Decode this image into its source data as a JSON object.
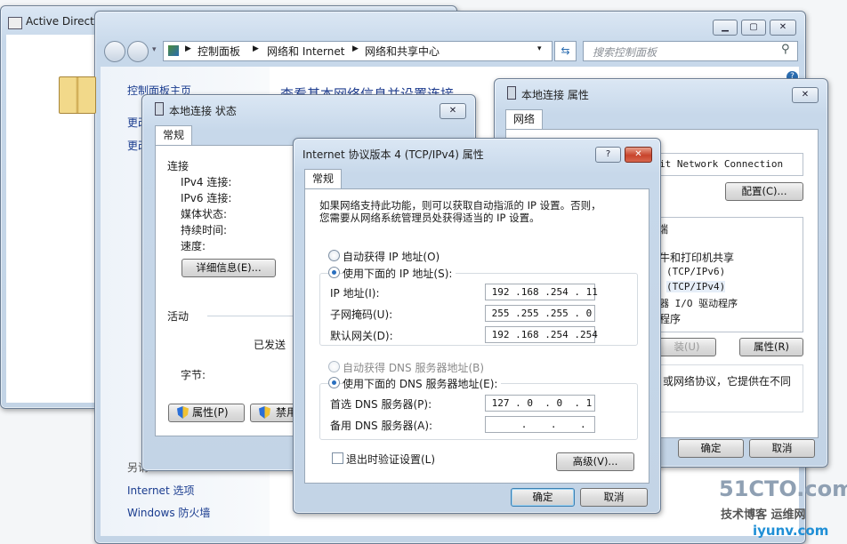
{
  "ad_window": {
    "title": "Active Directo"
  },
  "explorer": {
    "breadcrumb": [
      "控制面板",
      "网络和 Internet",
      "网络和共享中心"
    ],
    "search_placeholder": "搜索控制面板",
    "sidebar_home": "控制面板主页",
    "sidebar_item_1": "更改",
    "sidebar_item_2": "更改",
    "sidebar_see_also": "另请",
    "sidebar_internet_options": "Internet 选项",
    "sidebar_firewall": "Windows 防火墙",
    "main_heading": "查看基本网络信息并设置连接"
  },
  "status_dialog": {
    "title": "本地连接 状态",
    "tab": "常规",
    "connection_section": "连接",
    "ipv4": "IPv4 连接:",
    "ipv6": "IPv6 连接:",
    "media": "媒体状态:",
    "duration": "持续时间:",
    "speed": "速度:",
    "details_btn": "详细信息(E)...",
    "activity_section": "活动",
    "sent": "已发送",
    "bytes": "字节:",
    "properties_btn": "属性(P)",
    "disable_btn": "禁用"
  },
  "props_dialog": {
    "title": "本地连接 属性",
    "tab": "网络",
    "adapter": "it Network Connection",
    "configure_btn": "配置(C)...",
    "items": [
      "端",
      "牛和打印机共享",
      "(TCP/IPv6)",
      "(TCP/IPv4)",
      "器 I/O 驱动程序",
      "程序"
    ],
    "uninstall_btn": "装(U)",
    "properties_btn": "属性(R)",
    "desc": "或网络协议，它提供在不同",
    "ok": "确定",
    "cancel": "取消"
  },
  "ipv4_dialog": {
    "title": "Internet 协议版本 4 (TCP/IPv4) 属性",
    "help": "?",
    "tab": "常规",
    "intro_1": "如果网络支持此功能，则可以获取自动指派的 IP 设置。否则，",
    "intro_2": "您需要从网络系统管理员处获得适当的 IP 设置。",
    "auto_ip": "自动获得 IP 地址(O)",
    "manual_ip": "使用下面的 IP 地址(S):",
    "ip_label": "IP 地址(I):",
    "ip_value": " 192 .168 .254 . 11",
    "mask_label": "子网掩码(U):",
    "mask_value": " 255 .255 .255 . 0",
    "gateway_label": "默认网关(D):",
    "gateway_value": " 192 .168 .254 .254",
    "auto_dns": "自动获得 DNS 服务器地址(B)",
    "manual_dns": "使用下面的 DNS 服务器地址(E):",
    "dns1_label": "首选 DNS 服务器(P):",
    "dns1_value": " 127 . 0  . 0  . 1",
    "dns2_label": "备用 DNS 服务器(A):",
    "dns2_value": "      .    .    .",
    "validate": "退出时验证设置(L)",
    "advanced": "高级(V)...",
    "ok": "确定",
    "cancel": "取消"
  },
  "watermark": {
    "line1": "51CTO.com",
    "line2": "技术博客 运维网",
    "line3": "iyunv.com"
  }
}
